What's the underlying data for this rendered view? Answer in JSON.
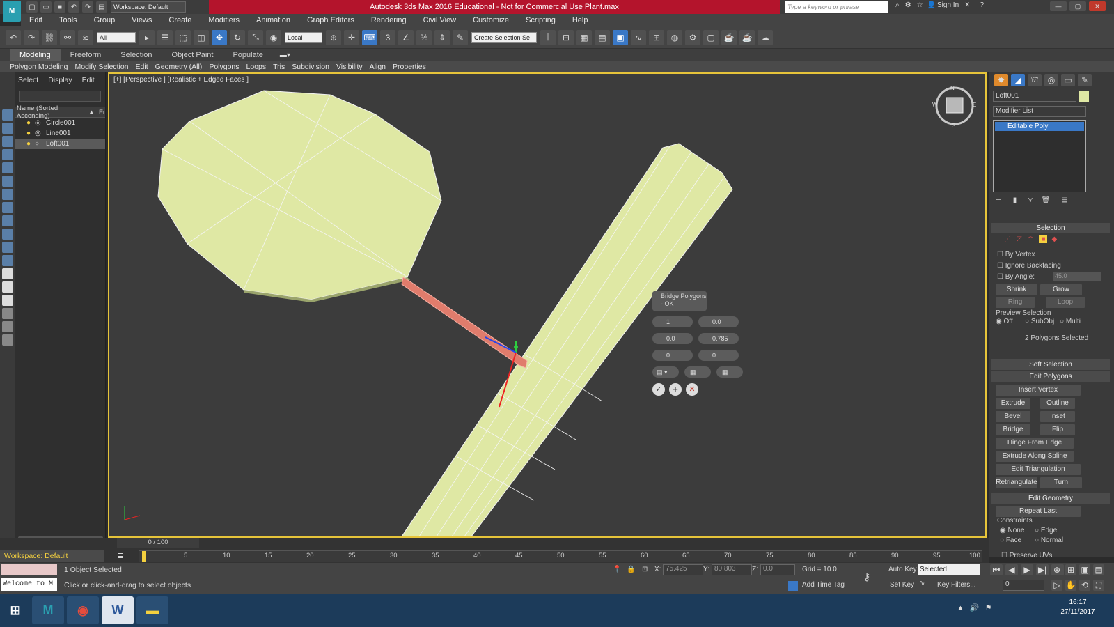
{
  "title": {
    "workspace_combo": "Workspace: Default",
    "text": "Autodesk 3ds Max 2016 Educational - Not for Commercial Use    Plant.max",
    "search_placeholder": "Type a keyword or phrase",
    "sign_in": "Sign In"
  },
  "menu": [
    "Edit",
    "Tools",
    "Group",
    "Views",
    "Create",
    "Modifiers",
    "Animation",
    "Graph Editors",
    "Rendering",
    "Civil View",
    "Customize",
    "Scripting",
    "Help"
  ],
  "toolbar": {
    "selection_filter": "All",
    "ref_coord": "Local",
    "named_selection": "Create Selection Se"
  },
  "ribbon": {
    "tabs": [
      "Modeling",
      "Freeform",
      "Selection",
      "Object Paint",
      "Populate"
    ],
    "items": [
      "Polygon Modeling",
      "Modify Selection",
      "Edit",
      "Geometry (All)",
      "Polygons",
      "Loops",
      "Tris",
      "Subdivision",
      "Visibility",
      "Align",
      "Properties"
    ]
  },
  "scene_explorer": {
    "tabs": [
      "Select",
      "Display",
      "Edit"
    ],
    "column_header": "Name (Sorted Ascending)",
    "column_header2": "Fr",
    "items": [
      "Circle001",
      "Line001",
      "Loft001"
    ]
  },
  "viewport": {
    "label": "[+] [Perspective ] [Realistic + Edged Faces ]",
    "caddy_title": "Bridge Polygons",
    "caddy_subtitle": "- OK",
    "segments": "1",
    "taper": "0.0",
    "bias": "0.0",
    "smooth": "0.785",
    "twist1": "0",
    "twist2": "0",
    "viewcube": {
      "n": "N",
      "w": "W",
      "e": "E",
      "s": "S"
    }
  },
  "command_panel": {
    "object_name": "Loft001",
    "modifier_list": "Modifier List",
    "stack_item": "Editable Poly",
    "selection": {
      "header": "Selection",
      "by_vertex": "By Vertex",
      "ignore_backfacing": "Ignore Backfacing",
      "by_angle": "By Angle:",
      "angle_value": "45.0",
      "shrink": "Shrink",
      "grow": "Grow",
      "ring": "Ring",
      "loop": "Loop",
      "preview_label": "Preview Selection",
      "preview_off": "Off",
      "preview_subobj": "SubObj",
      "preview_multi": "Multi",
      "status": "2 Polygons Selected"
    },
    "soft_selection": "Soft Selection",
    "edit_polygons": {
      "header": "Edit Polygons",
      "insert_vertex": "Insert Vertex",
      "extrude": "Extrude",
      "outline": "Outline",
      "bevel": "Bevel",
      "inset": "Inset",
      "bridge": "Bridge",
      "flip": "Flip",
      "hinge": "Hinge From Edge",
      "extrude_spline": "Extrude Along Spline",
      "edit_tri": "Edit Triangulation",
      "retriangulate": "Retriangulate",
      "turn": "Turn"
    },
    "edit_geometry": {
      "header": "Edit Geometry",
      "repeat_last": "Repeat Last",
      "constraints": "Constraints",
      "none": "None",
      "edge": "Edge",
      "face": "Face",
      "normal": "Normal",
      "preserve_uvs": "Preserve UVs"
    }
  },
  "timeline": {
    "frame": "0 / 100",
    "ticks": [
      "5",
      "10",
      "15",
      "20",
      "25",
      "30",
      "35",
      "40",
      "45",
      "50",
      "55",
      "60",
      "65",
      "70",
      "75",
      "80",
      "85",
      "90",
      "95",
      "100"
    ]
  },
  "status": {
    "workspace": "Workspace: Default",
    "maxscript": "Welcome to M",
    "selected": "1 Object Selected",
    "prompt": "Click or click-and-drag to select objects",
    "x_label": "X:",
    "x": "75.425",
    "y_label": "Y:",
    "y": "80.803",
    "z_label": "Z:",
    "z": "0.0",
    "grid": "Grid = 10.0",
    "add_time_tag": "Add Time Tag",
    "auto_key": "Auto Key",
    "set_key": "Set Key",
    "key_mode": "Selected",
    "key_filters": "Key Filters...",
    "frame_field": "0"
  },
  "taskbar": {
    "time": "16:17",
    "date": "27/11/2017",
    "apps": [
      "W"
    ]
  },
  "colors": {
    "accent": "#3a78c6",
    "viewport_border": "#e6c43a",
    "mesh": "#dfe8a4",
    "selected_poly": "#e07c6c",
    "title_red": "#b4142c"
  }
}
